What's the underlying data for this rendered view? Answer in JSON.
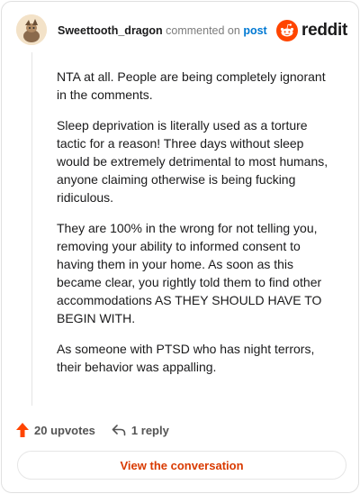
{
  "header": {
    "username": "Sweettooth_dragon",
    "commented_text": "commented on",
    "post_link": "post",
    "brand_name": "reddit",
    "brand_color": "#ff4500"
  },
  "comment": {
    "paragraphs": [
      "NTA at all. People are being completely ignorant in the comments.",
      "Sleep deprivation is literally used as a torture tactic for a reason! Three days without sleep would be extremely detrimental to most humans, anyone claiming otherwise is being fucking ridiculous.",
      "They are 100% in the wrong for not telling you, removing your ability to informed consent to having them in your home. As soon as this became clear, you rightly told them to find other accommodations AS THEY SHOULD HAVE TO BEGIN WITH.",
      "As someone with PTSD who has night terrors, their behavior was appalling."
    ]
  },
  "footer": {
    "upvotes_label": "20 upvotes",
    "reply_label": "1 reply",
    "upvote_color": "#ff4500"
  },
  "view_button": {
    "label": "View the conversation",
    "color": "#d93a00"
  }
}
